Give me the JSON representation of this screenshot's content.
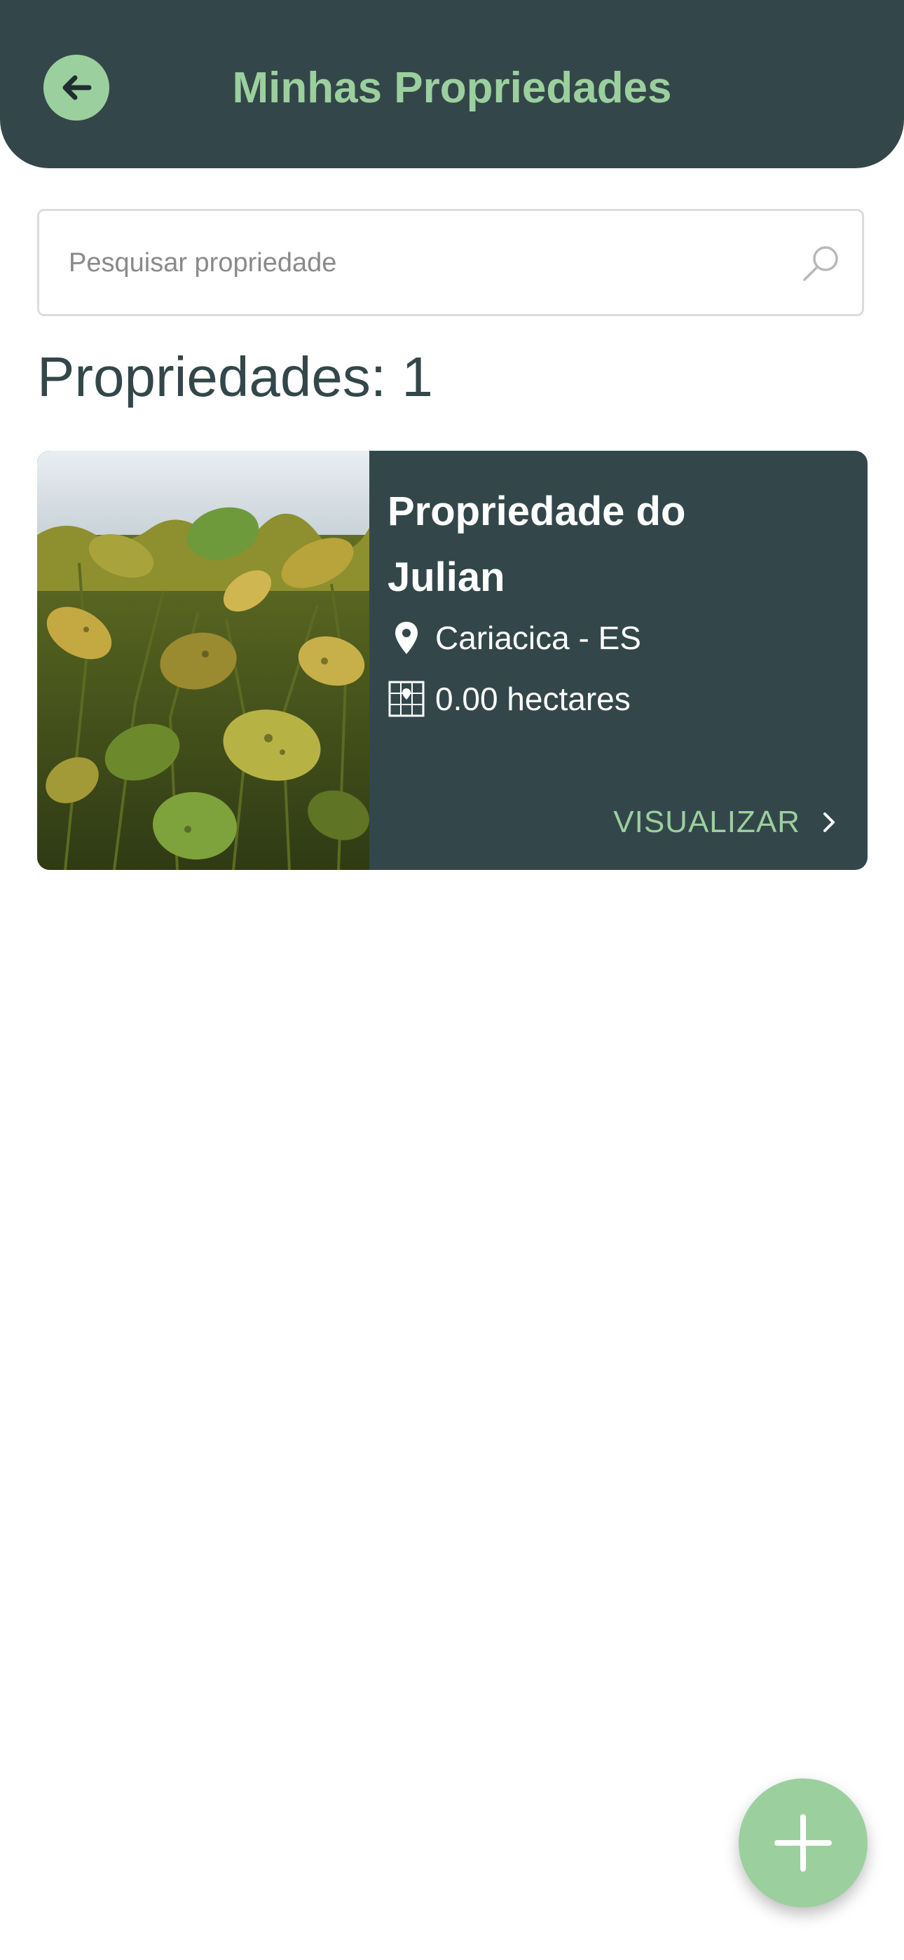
{
  "header": {
    "title": "Minhas Propriedades",
    "back_icon": "arrow-left-icon"
  },
  "search": {
    "placeholder": "Pesquisar propriedade",
    "value": "",
    "icon": "search-icon"
  },
  "properties": {
    "count_label": "Propriedades: 1",
    "items": [
      {
        "name": "Propriedade do Julian",
        "location": "Cariacica - ES",
        "area": "0.00 hectares",
        "action_label": "VISUALIZAR",
        "image": "soybean-field-photo"
      }
    ]
  },
  "fab": {
    "icon": "plus-icon"
  },
  "colors": {
    "header_bg": "#33474a",
    "accent_green": "#9ccf9e",
    "card_bg": "#33474a",
    "text_dark": "#33474a"
  }
}
